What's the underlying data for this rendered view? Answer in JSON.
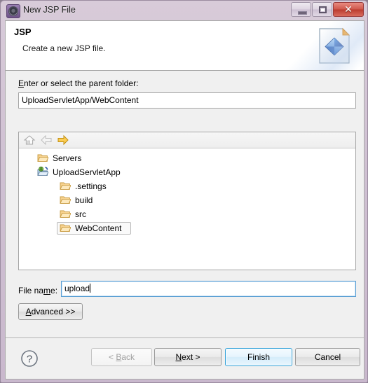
{
  "window": {
    "title": "New JSP File",
    "icon": "jsp-wizard-icon",
    "controls": {
      "minimize": "minimize-button",
      "maximize": "restore-button",
      "close": "close-button",
      "close_glyph": "✕"
    }
  },
  "header": {
    "title": "JSP",
    "description": "Create a new JSP file.",
    "icon": "jsp-file-document-icon"
  },
  "parent_folder": {
    "label_pre": "E",
    "label_post": "nter or select the parent folder:",
    "value": "UploadServletApp/WebContent"
  },
  "tree": {
    "toolbar": [
      {
        "name": "home-icon",
        "enabled": false
      },
      {
        "name": "back-arrow-icon",
        "enabled": false
      },
      {
        "name": "forward-arrow-icon",
        "enabled": true
      }
    ],
    "items": [
      {
        "label": "Servers",
        "icon": "folder-icon",
        "indent": 0,
        "selected": false
      },
      {
        "label": "UploadServletApp",
        "icon": "web-project-folder-icon",
        "indent": 0,
        "selected": false
      },
      {
        "label": ".settings",
        "icon": "folder-icon",
        "indent": 1,
        "selected": false
      },
      {
        "label": "build",
        "icon": "folder-icon",
        "indent": 1,
        "selected": false
      },
      {
        "label": "src",
        "icon": "folder-icon",
        "indent": 1,
        "selected": false
      },
      {
        "label": "WebContent",
        "icon": "folder-icon",
        "indent": 1,
        "selected": true
      }
    ]
  },
  "file_name": {
    "label_pre": "File na",
    "label_mid": "m",
    "label_post": "e:",
    "value": "upload"
  },
  "advanced": {
    "label_pre": "A",
    "label_post": "dvanced >>"
  },
  "buttons": {
    "help": "help-button",
    "back": "< Back",
    "back_pre": "< ",
    "back_mid": "B",
    "back_post": "ack",
    "next_pre": "",
    "next_mid": "N",
    "next_post": "ext >",
    "finish": "Finish",
    "cancel": "Cancel"
  },
  "colors": {
    "frame": "#cfc0d2",
    "accent": "#2e9fd8",
    "close": "#bb3c30",
    "folder": "#f5c465",
    "gem": "#2a6fd4"
  }
}
